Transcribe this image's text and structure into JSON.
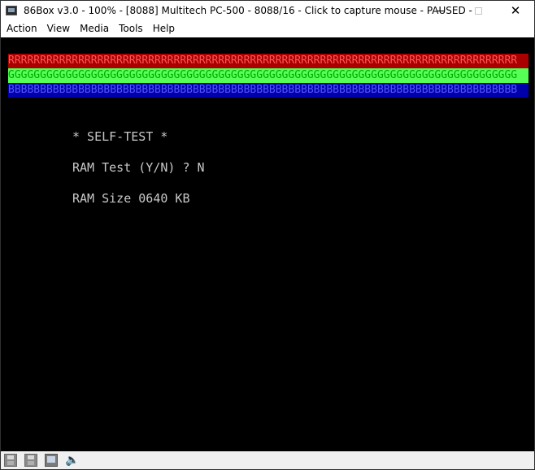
{
  "window": {
    "title": "86Box v3.0 - 100% - [8088] Multitech PC-500 - 8088/16 - Click to capture mouse - PAUSED -",
    "controls": {
      "minimize": "minimize",
      "maximize": "maximize",
      "close": "✕"
    }
  },
  "menubar": {
    "items": [
      {
        "label": "Action"
      },
      {
        "label": "View"
      },
      {
        "label": "Media"
      },
      {
        "label": "Tools"
      },
      {
        "label": "Help"
      }
    ]
  },
  "screen": {
    "bands": {
      "red": "RRRRRRRRRRRRRRRRRRRRRRRRRRRRRRRRRRRRRRRRRRRRRRRRRRRRRRRRRRRRRRRRRRRRRRRRRRRRRRRR",
      "green": "GGGGGGGGGGGGGGGGGGGGGGGGGGGGGGGGGGGGGGGGGGGGGGGGGGGGGGGGGGGGGGGGGGGGGGGGGGGGGGGG",
      "blue": "BBBBBBBBBBBBBBBBBBBBBBBBBBBBBBBBBBBBBBBBBBBBBBBBBBBBBBBBBBBBBBBBBBBBBBBBBBBBBBBB"
    },
    "lines": [
      "* SELF-TEST *",
      "RAM Test (Y/N) ? N",
      "RAM Size 0640 KB"
    ],
    "colors": {
      "background": "#000000",
      "text": "#c8c8c8",
      "red_band_bg": "#aa0000",
      "red_band_fg": "#ff5555",
      "green_band_bg": "#55ff55",
      "green_band_fg": "#00aa00",
      "blue_band_bg": "#0000aa",
      "blue_band_fg": "#5555ff"
    }
  },
  "statusbar": {
    "icons": [
      {
        "name": "floppy-drive-1-icon"
      },
      {
        "name": "floppy-drive-2-icon"
      },
      {
        "name": "display-icon"
      },
      {
        "name": "speaker-icon"
      }
    ]
  }
}
